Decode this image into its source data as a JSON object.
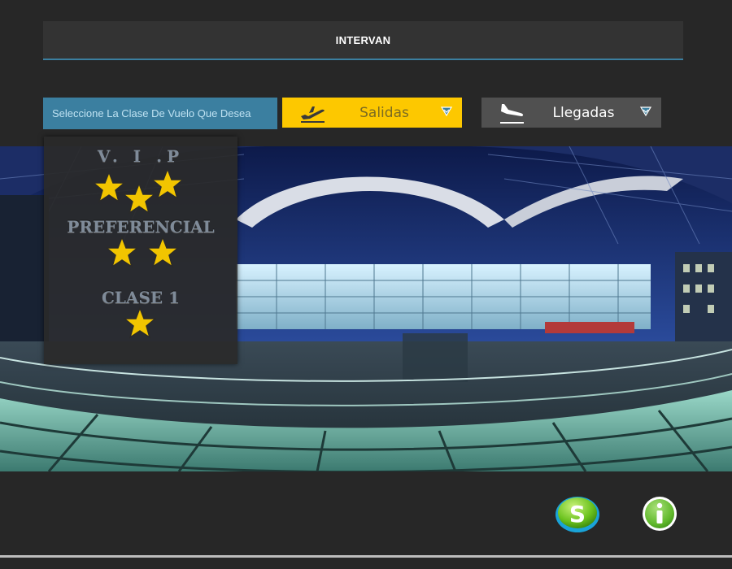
{
  "header": {
    "title": "INTERVAN"
  },
  "class_selector": {
    "label": "Seleccione La Clase De Vuelo Que Desea"
  },
  "departures": {
    "label": "Salidas"
  },
  "arrivals": {
    "label": "Llegadas"
  },
  "class_menu": {
    "items": [
      {
        "name": "V. I .P",
        "stars": 3
      },
      {
        "name": "PREFERENCIAL",
        "stars": 2
      },
      {
        "name": "CLASE 1",
        "stars": 1
      }
    ]
  },
  "icons": {
    "departure": "airplane-takeoff-icon",
    "arrival": "airplane-landing-icon",
    "chevron": "chevron-down-icon",
    "skype": "skype-icon",
    "info": "info-icon"
  },
  "colors": {
    "accent_blue": "#3b7fa0",
    "departures_yellow": "#fdc800",
    "arrivals_gray": "#505050",
    "star_gold": "#f2c500",
    "info_green": "#5fb82a"
  }
}
